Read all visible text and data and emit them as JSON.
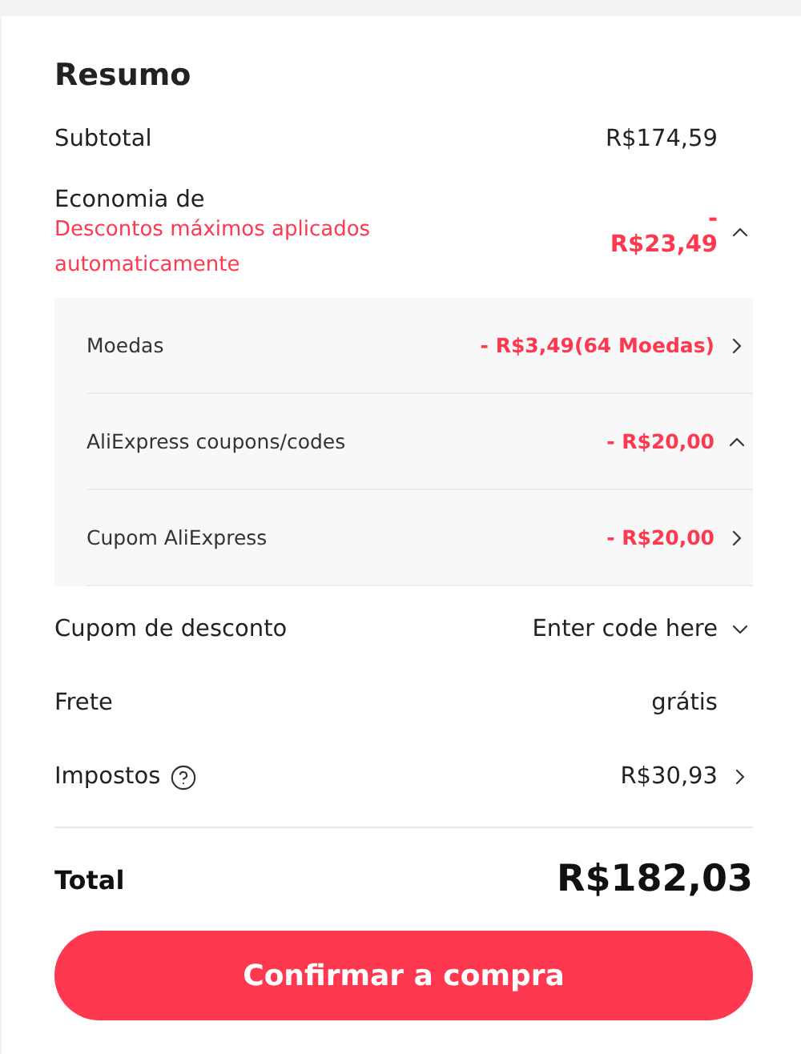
{
  "title": "Resumo",
  "subtotal": {
    "label": "Subtotal",
    "value": "R$174,59"
  },
  "savings": {
    "label": "Economia de",
    "note": "Descontos máximos aplicados automaticamente",
    "value": "- R$23,49",
    "expanded": true,
    "items": [
      {
        "label": "Moedas",
        "value": "- R$3,49(64 Moedas)",
        "kind": "link"
      },
      {
        "label": "AliExpress coupons/codes",
        "value": "- R$20,00",
        "kind": "group",
        "expanded": true
      },
      {
        "label": "Cupom AliExpress",
        "value": "- R$20,00",
        "kind": "link"
      }
    ]
  },
  "rows": [
    {
      "label": "Cupom de desconto",
      "value": "Enter code here",
      "kind": "dropdown",
      "expanded": false
    },
    {
      "label": "Frete",
      "value": "grátis",
      "kind": "plain"
    },
    {
      "label": "Impostos",
      "value": "R$30,93",
      "kind": "link",
      "help": true
    }
  ],
  "total": {
    "label": "Total",
    "value": "R$182,03"
  },
  "button": "Confirmar a compra"
}
